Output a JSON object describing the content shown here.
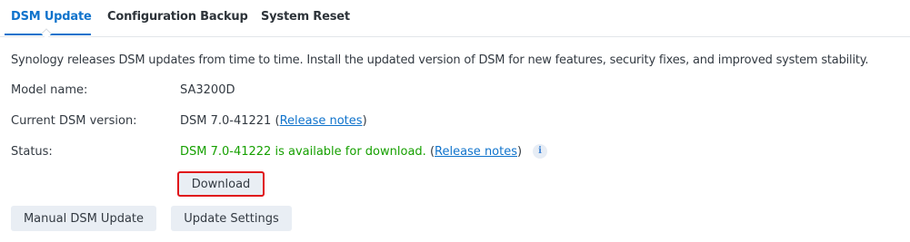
{
  "tabs": [
    {
      "label": "DSM Update",
      "active": true
    },
    {
      "label": "Configuration Backup",
      "active": false
    },
    {
      "label": "System Reset",
      "active": false
    }
  ],
  "intro": "Synology releases DSM updates from time to time. Install the updated version of DSM for new features, security fixes, and improved system stability.",
  "model": {
    "label": "Model name:",
    "value": "SA3200D"
  },
  "current_version": {
    "label": "Current DSM version:",
    "value": "DSM 7.0-41221",
    "open_paren": "(",
    "link": "Release notes",
    "close_paren": ")"
  },
  "status": {
    "label": "Status:",
    "value": "DSM 7.0-41222 is available for download.",
    "open_paren": "(",
    "link": "Release notes",
    "close_paren": ")",
    "info_icon": "i"
  },
  "buttons": {
    "download": "Download",
    "manual_update": "Manual DSM Update",
    "update_settings": "Update Settings"
  },
  "colors": {
    "accent": "#0f73cc",
    "status_ok": "#16a000",
    "highlight_border": "#e0141a",
    "button_bg": "#e9eef4"
  }
}
